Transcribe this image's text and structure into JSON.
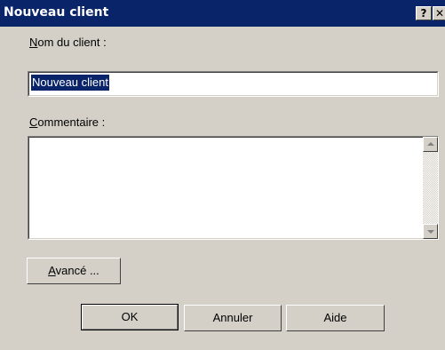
{
  "window": {
    "title": "Nouveau client"
  },
  "title_buttons": {
    "help": "?",
    "close": "✕"
  },
  "name_field": {
    "label_prefix": "N",
    "label_rest": "om du client :",
    "value": "Nouveau client"
  },
  "comment_field": {
    "label_prefix": "C",
    "label_rest": "ommentaire :",
    "value": ""
  },
  "buttons": {
    "advanced_prefix": "A",
    "advanced_rest": "vancé ...",
    "ok": "OK",
    "cancel": "Annuler",
    "help": "Aide"
  }
}
